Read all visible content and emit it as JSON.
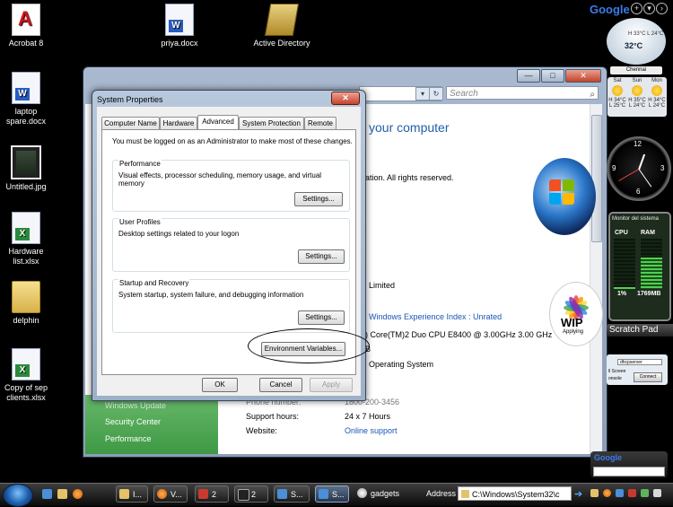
{
  "desktop": {
    "icons": [
      {
        "label": "Acrobat 8"
      },
      {
        "label": "laptop spare.docx"
      },
      {
        "label": "Untitled.jpg"
      },
      {
        "label": "Hardware list.xlsx"
      },
      {
        "label": "delphin"
      },
      {
        "label": "Copy of sep clients.xlsx"
      },
      {
        "label": "priya.docx"
      },
      {
        "label": "Active Directory"
      }
    ]
  },
  "background_window": {
    "search_placeholder": "Search",
    "heading": "your computer",
    "copyright_text": "ation.  All rights reserved.",
    "manufacturer": "Limited",
    "wei_link": "Windows Experience Index : Unrated",
    "cpu": ") Core(TM)2 Duo CPU     E8400  @ 3.00GHz   3.00 GHz",
    "mem_frag": "B",
    "os_type": "Operating System",
    "left_links": [
      "Windows Update",
      "Security Center",
      "Performance"
    ],
    "support": [
      {
        "label": "Phone number:",
        "value": "1800-200-3456",
        "link": false
      },
      {
        "label": "Support hours:",
        "value": "24 x 7 Hours",
        "link": false
      },
      {
        "label": "Website:",
        "value": "Online support",
        "link": true
      }
    ],
    "logo_text": "WIP",
    "logo_sub": "Applying"
  },
  "dialog": {
    "title": "System Properties",
    "close_glyph": "✕",
    "tabs": [
      "Computer Name",
      "Hardware",
      "Advanced",
      "System Protection",
      "Remote"
    ],
    "active_tab": "Advanced",
    "admin_note": "You must be logged on as an Administrator to make most of these changes.",
    "performance": {
      "label": "Performance",
      "desc": "Visual effects, processor scheduling, memory usage, and virtual memory",
      "button": "Settings..."
    },
    "user_profiles": {
      "label": "User Profiles",
      "desc": "Desktop settings related to your logon",
      "button": "Settings..."
    },
    "startup": {
      "label": "Startup and Recovery",
      "desc": "System startup, system failure, and debugging information",
      "button": "Settings..."
    },
    "env_button": "Environment Variables...",
    "ok": "OK",
    "cancel": "Cancel",
    "apply": "Apply"
  },
  "sidebar": {
    "google_logo": "Google",
    "weather": {
      "temp": "32°C",
      "range": "H 33°C  L 24°C",
      "city": "Chennai",
      "forecast": [
        {
          "day": "Sat",
          "hi": "H 34°C",
          "lo": "L 25°C"
        },
        {
          "day": "Sun",
          "hi": "H 35°C",
          "lo": "L 24°C"
        },
        {
          "day": "Mon",
          "hi": "H 34°C",
          "lo": "L 24°C"
        }
      ]
    },
    "clock_numbers": [
      "12",
      "3",
      "6",
      "9"
    ],
    "monitor": {
      "title": "Monitor del sistema",
      "cpu_label": "CPU",
      "ram_label": "RAM",
      "cpu_value": "1%",
      "ram_value": "1769MB",
      "cpu_level": 0.02,
      "ram_level": 0.62
    },
    "scratch_pad": "Scratch Pad",
    "rdp": {
      "server": "dhcpserver",
      "line1": "ll Screen",
      "line2": "onsole",
      "connect": "Connect"
    },
    "google_search_logo": "Google"
  },
  "taskbar": {
    "buttons": [
      {
        "label": "I..."
      },
      {
        "label": "V..."
      },
      {
        "label": "2"
      },
      {
        "label": "2"
      },
      {
        "label": "S..."
      },
      {
        "label": "S..."
      },
      {
        "label": "gadgets"
      }
    ],
    "address_label": "Address",
    "address_value": "C:\\Windows\\System32\\c"
  }
}
